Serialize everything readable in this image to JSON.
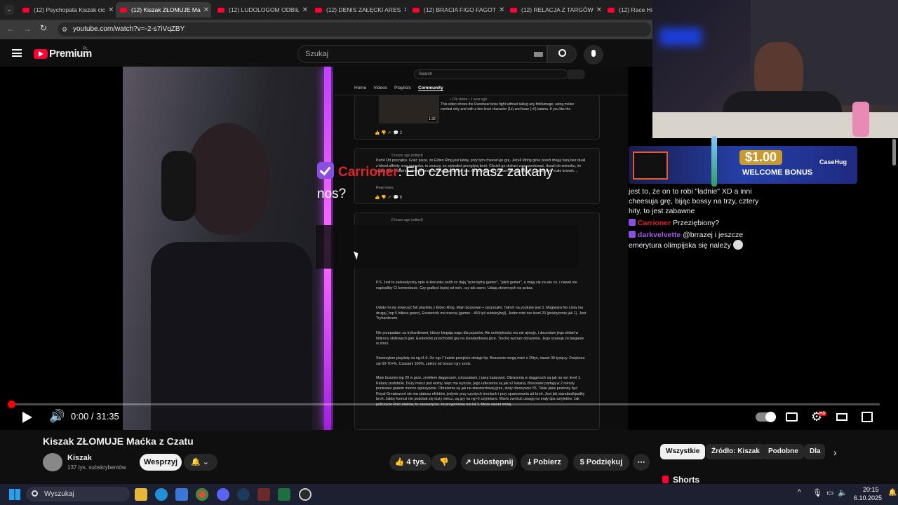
{
  "browser": {
    "tabs": [
      {
        "label": "(12) Psychopata Kiszak cic"
      },
      {
        "label": "(12) Kiszak ZŁOMUJE Ma"
      },
      {
        "label": "(12) LUDOLOGOM ODBIŁ"
      },
      {
        "label": "(12) DENIS ZAŁĘCKI ARES"
      },
      {
        "label": "(12) BRACIA FIGO FAGOT"
      },
      {
        "label": "(12) RELACJA Z TARGÓW"
      },
      {
        "label": "(12) Race High"
      }
    ],
    "url": "youtube.com/watch?v=-2-s7iVqZBY"
  },
  "youtube": {
    "logo_text": "Premium",
    "logo_region": "PL",
    "search_placeholder": "Szukaj"
  },
  "embedded_page": {
    "search_placeholder": "Search",
    "tabs": [
      "Home",
      "Videos",
      "Playlists",
      "Community"
    ],
    "post1_meta": "• 10k views • 1 year ago",
    "post1_duration": "1:32",
    "post1_text": "This video shows the Runebear boss fight without taking any hit/damage, using melee combat only and with a low-level character (1s) and base (+0) katana. If you like the video...",
    "post1_likes": "2",
    "post2_time": "5 hours ago (edited)",
    "post2_text": "Part4 Od początku. Gość pisze, że Elden Ring jest łatwy, przy tym cheese'uje grę. Jeżeli Mohg ginie przed drugą fazą bez duali z bleed affinity oraz seppuku, to znaczy, że wybrałeś przegiętą broń. Chcieli go dobrze zaprezentować, doszli do wniosku, że zagra Star Fistami z cheese itemizacją oraz z crystal tear na dodatkowe przełamywanie postury. Jakby były mało bronek. ..",
    "post2_readmore": "Read more",
    "post2_likes": "6",
    "post3_time": "6 hours ago (edited)",
    "post3_text": "P.S. Jest to sarkastyczny opis w kierunku osób co dają \"przeciętny gamer\", \"jakiś gamer\", a mają się za wie co, i nawet nie napisaliby Ci komentarze. Czy grałbyś lepiej od nich, czy tak samo. Udają skromnych na pokaz.",
    "post3_text2": "Udało mi się stworzyć full playlistę z Elden Ring, Main bossowie + opcjonalni. Takich na youtube jest 3. Mugiwara No Lima ma drugą ( top 5 hitless gracz), Esoterickk ma trzecią (gamer - 450 tyś subskrybcji). Jeden robi run level 20 (praktycznie jak 1). Jest Tryharderem.",
    "post3_text3": "Nie przepadam za tryharderami, którzy biegają nago dla popisów. Ale umiejętności mu nie ujmuję, i doceniam jego wkład w hitless'y skillowych gier. Esoterickk przechodził grę na standardowej grze. Trochę wyższe obrażenia. Jego szanuję za bieganie w zbroi.",
    "post3_text4": "Stworzyłem playlistę na ng+4-6. Do ng+7 każde przejście dodaje hp. Bossowie mogą mieć z 20tyś, nawet 30 tysięcy. Zwiększa się 50-70+%. Czasami 100%, zależy od bossa i gry souls.",
    "post3_text5": "Main bossów top 20 w grze, zrobiłem daggerami, colossalami, i parę katanami. Obrażenia w daggersch są jak na run level 1. Katany podobnie. Duży miecz jest wolny, więc ma wyższe, jego uderzenia są jak x2 kataną. Bossowie padają w 2 minuty ponieważ grałem mocno agresywnie. Obrażenia są jak na standardowej grze, staty ofensywne 55. Takie jakie powinny być. Royal Greatsword nie ma statusu efektów, jedynie przy czystych broniach i przy spamowaniu art broń. Jest jak standard/quality broń. Jakby komuś nie podobał się duży miecz, są gry na ng+5 sztyletami. Warto zwrócić uwagę na mały dps sztyletów. Jak policzycie Roić ataków, to zauważycie, że przypomina run lvl 1. Może nawet mniej."
  },
  "overlay_chat": {
    "username": "Carrioner",
    "message": ": Elo czemu masz zatkany nos?"
  },
  "promo": {
    "amount": "$1.00",
    "label": "WELCOME BONUS",
    "brand": "CaseHug"
  },
  "stream_chat": [
    {
      "user": "",
      "text": "jest to, że on to robi \"ładnie\" XD a inni cheesuja grę, bijąc bossy na trzy, cztery hity, to jest zabawne"
    },
    {
      "user": "Carrioner",
      "text": "Przeziębiony?"
    },
    {
      "user": "darkvelvette",
      "text": "@brrazej i jeszcze emerytura olimpijska się należy"
    }
  ],
  "player": {
    "time": "0:00 / 31:35",
    "progress_fraction": 0.0
  },
  "video": {
    "title": "Kiszak ZŁOMUJE Maćka z Czatu",
    "channel": "Kiszak",
    "subscribers": "137 tys. subskrybentów",
    "support_label": "Wesprzyj",
    "likes": "4 tys.",
    "share_label": "Udostępnij",
    "download_label": "Pobierz",
    "thanks_label": "Podziękuj"
  },
  "chips": [
    "Wszystkie",
    "Źródło: Kiszak",
    "Podobne",
    "Dla C"
  ],
  "shorts_label": "Shorts",
  "taskbar": {
    "search_placeholder": "Wyszukaj",
    "time": "20:15",
    "date": "6.10.2025"
  },
  "colors": {
    "accent_red": "#ff0033",
    "neon": "#c040ff",
    "chat_name_red": "#e0242b",
    "chat_name_purple": "#a45de8"
  }
}
